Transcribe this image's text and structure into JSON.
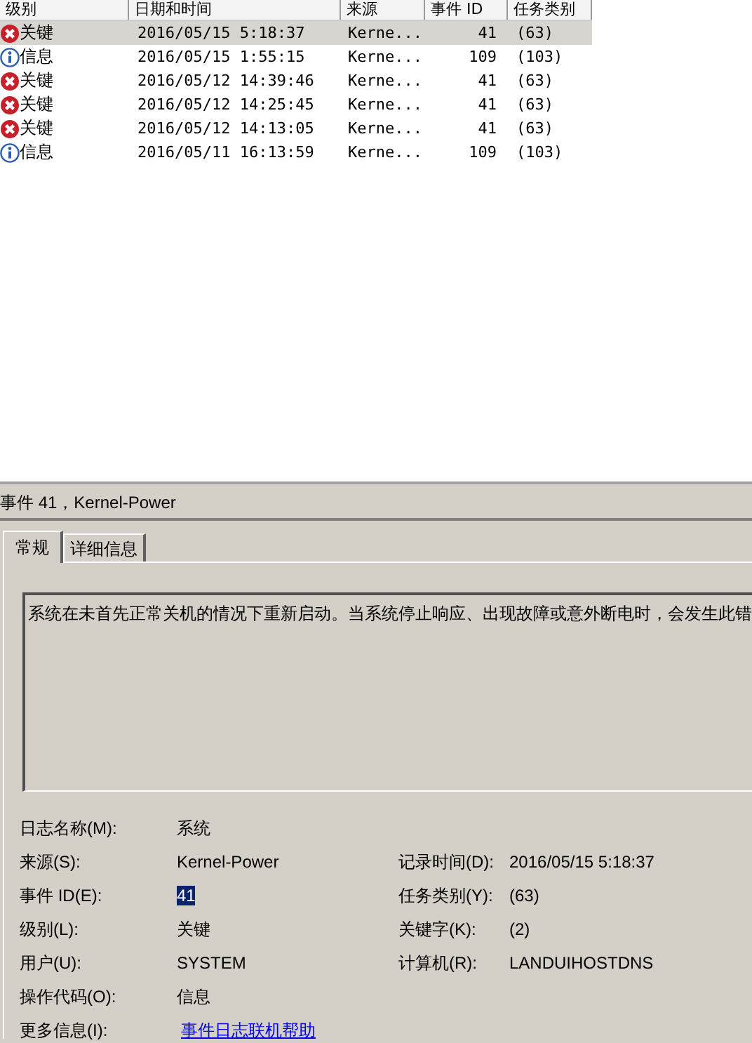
{
  "event_list": {
    "columns": [
      "级别",
      "日期和时间",
      "来源",
      "事件 ID",
      "任务类别"
    ],
    "rows": [
      {
        "kind": "error",
        "level": "关键",
        "date_time": "2016/05/15 5:18:37",
        "source": "Kerne...",
        "event_id": "41",
        "task_category": "(63)",
        "selected": true
      },
      {
        "kind": "info",
        "level": "信息",
        "date_time": "2016/05/15 1:55:15",
        "source": "Kerne...",
        "event_id": "109",
        "task_category": "(103)",
        "selected": false
      },
      {
        "kind": "error",
        "level": "关键",
        "date_time": "2016/05/12 14:39:46",
        "source": "Kerne...",
        "event_id": "41",
        "task_category": "(63)",
        "selected": false
      },
      {
        "kind": "error",
        "level": "关键",
        "date_time": "2016/05/12 14:25:45",
        "source": "Kerne...",
        "event_id": "41",
        "task_category": "(63)",
        "selected": false
      },
      {
        "kind": "error",
        "level": "关键",
        "date_time": "2016/05/12 14:13:05",
        "source": "Kerne...",
        "event_id": "41",
        "task_category": "(63)",
        "selected": false
      },
      {
        "kind": "info",
        "level": "信息",
        "date_time": "2016/05/11 16:13:59",
        "source": "Kerne...",
        "event_id": "109",
        "task_category": "(103)",
        "selected": false
      }
    ]
  },
  "detail": {
    "title": "事件 41，Kernel-Power",
    "tabs": [
      {
        "label": "常规",
        "selected": true
      },
      {
        "label": "详细信息",
        "selected": false
      }
    ],
    "description": "系统在未首先正常关机的情况下重新启动。当系统停止响应、出现故障或意外断电时，会发生此错",
    "rows": [
      {
        "left": {
          "label": "日志名称(M):",
          "value": "系统",
          "kind": "text",
          "highlighted": false
        }
      },
      {
        "left": {
          "label": "来源(S):",
          "value": "Kernel-Power",
          "kind": "text",
          "highlighted": false
        },
        "right": {
          "label": "记录时间(D):",
          "value": "2016/05/15 5:18:37",
          "kind": "text",
          "highlighted": false
        }
      },
      {
        "left": {
          "label": "事件 ID(E):",
          "value": "41",
          "kind": "text",
          "highlighted": true
        },
        "right": {
          "label": "任务类别(Y):",
          "value": "(63)",
          "kind": "text",
          "highlighted": false
        }
      },
      {
        "left": {
          "label": "级别(L):",
          "value": "关键",
          "kind": "text",
          "highlighted": false
        },
        "right": {
          "label": "关键字(K):",
          "value": "(2)",
          "kind": "text",
          "highlighted": false
        }
      },
      {
        "left": {
          "label": "用户(U):",
          "value": "SYSTEM",
          "kind": "text",
          "highlighted": false
        },
        "right": {
          "label": "计算机(R):",
          "value": "LANDUIHOSTDNS",
          "kind": "text",
          "highlighted": false
        }
      },
      {
        "left": {
          "label": "操作代码(O):",
          "value": "信息",
          "kind": "text",
          "highlighted": false
        }
      },
      {
        "left": {
          "label": "更多信息(I):",
          "value": "事件日志联机帮助",
          "kind": "link",
          "highlighted": false
        }
      }
    ]
  }
}
